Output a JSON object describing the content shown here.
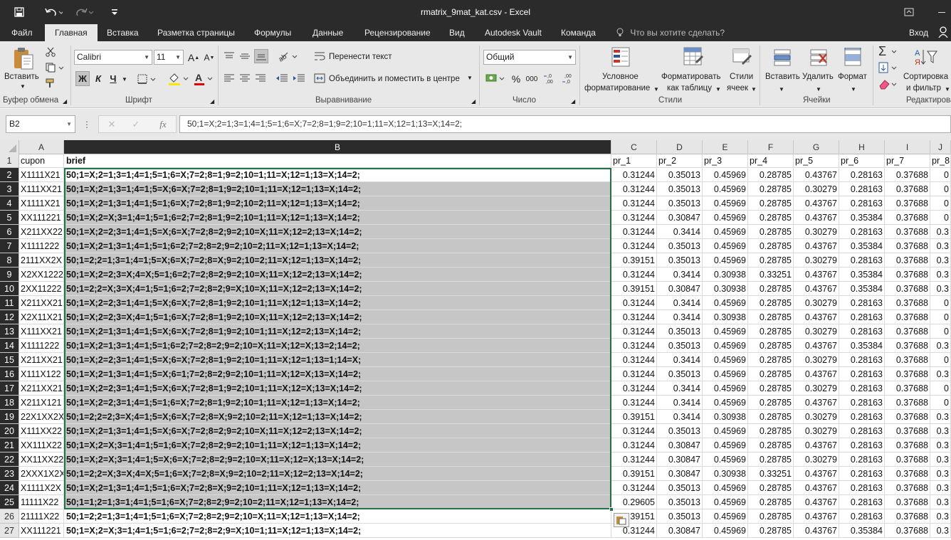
{
  "window": {
    "title": "rmatrix_9mat_kat.csv - Excel",
    "user": "Вход"
  },
  "tabs": [
    "Файл",
    "Главная",
    "Вставка",
    "Разметка страницы",
    "Формулы",
    "Данные",
    "Рецензирование",
    "Вид",
    "Autodesk Vault",
    "Команда"
  ],
  "active_tab": "Главная",
  "tell_me": "Что вы хотите сделать?",
  "ribbon": {
    "clipboard": {
      "paste": "Вставить",
      "group": "Буфер обмена"
    },
    "font": {
      "name": "Calibri",
      "size": "11",
      "bold": "Ж",
      "italic": "К",
      "underline": "Ч",
      "group": "Шрифт"
    },
    "alignment": {
      "wrap": "Перенести текст",
      "merge": "Объединить и поместить в центре",
      "group": "Выравнивание"
    },
    "number": {
      "format": "Общий",
      "group": "Число"
    },
    "styles": {
      "conditional_1": "Условное",
      "conditional_2": "форматирование",
      "format_table_1": "Форматировать",
      "format_table_2": "как таблицу",
      "cell_styles_1": "Стили",
      "cell_styles_2": "ячеек",
      "group": "Стили"
    },
    "cells": {
      "insert": "Вставить",
      "delete": "Удалить",
      "format": "Формат",
      "group": "Ячейки"
    },
    "editing": {
      "sort_1": "Сортировка",
      "sort_2": "и фильтр",
      "group": "Редактирование"
    }
  },
  "formula_bar": {
    "name_box": "B2",
    "fx": "fx",
    "value": "50;1=X;2=1;3=1;4=1;5=1;6=X;7=2;8=1;9=2;10=1;11=X;12=1;13=X;14=2;"
  },
  "sheet": {
    "columns": [
      "A",
      "B",
      "C",
      "D",
      "E",
      "F",
      "G",
      "H",
      "I",
      "J"
    ],
    "row_numbers": [
      "1",
      "2",
      "3",
      "4",
      "5",
      "6",
      "7",
      "8",
      "9",
      "10",
      "11",
      "12",
      "13",
      "14",
      "15",
      "16",
      "17",
      "18",
      "19",
      "20",
      "21",
      "22",
      "23",
      "24",
      "25",
      "26",
      "27"
    ],
    "header_row": [
      "cupon",
      "brief",
      "pr_1",
      "pr_2",
      "pr_3",
      "pr_4",
      "pr_5",
      "pr_6",
      "pr_7",
      "pr_8"
    ],
    "rows": [
      [
        "X1111X21",
        "50;1=X;2=1;3=1;4=1;5=1;6=X;7=2;8=1;9=2;10=1;11=X;12=1;13=X;14=2;",
        "0.31244",
        "0.35013",
        "0.45969",
        "0.28785",
        "0.43767",
        "0.28163",
        "0.37688",
        "0"
      ],
      [
        "X111XX21",
        "50;1=X;2=1;3=1;4=1;5=X;6=X;7=2;8=1;9=2;10=1;11=X;12=1;13=X;14=2;",
        "0.31244",
        "0.35013",
        "0.45969",
        "0.28785",
        "0.30279",
        "0.28163",
        "0.37688",
        "0"
      ],
      [
        "X1111X21",
        "50;1=X;2=1;3=1;4=1;5=1;6=X;7=2;8=1;9=2;10=2;11=X;12=1;13=X;14=2;",
        "0.31244",
        "0.35013",
        "0.45969",
        "0.28785",
        "0.43767",
        "0.28163",
        "0.37688",
        "0"
      ],
      [
        "XX111221",
        "50;1=X;2=X;3=1;4=1;5=1;6=2;7=2;8=1;9=2;10=1;11=X;12=1;13=X;14=2;",
        "0.31244",
        "0.30847",
        "0.45969",
        "0.28785",
        "0.43767",
        "0.35384",
        "0.37688",
        "0"
      ],
      [
        "X211XX22",
        "50;1=X;2=2;3=1;4=1;5=X;6=X;7=2;8=2;9=2;10=X;11=X;12=2;13=X;14=2;",
        "0.31244",
        "0.3414",
        "0.45969",
        "0.28785",
        "0.30279",
        "0.28163",
        "0.37688",
        "0.3"
      ],
      [
        "X1111222",
        "50;1=X;2=1;3=1;4=1;5=1;6=2;7=2;8=2;9=2;10=2;11=X;12=1;13=X;14=2;",
        "0.31244",
        "0.35013",
        "0.45969",
        "0.28785",
        "0.43767",
        "0.35384",
        "0.37688",
        "0.3"
      ],
      [
        "2111XX2X",
        "50;1=2;2=1;3=1;4=1;5=X;6=X;7=2;8=X;9=2;10=2;11=X;12=1;13=X;14=2;",
        "0.39151",
        "0.35013",
        "0.45969",
        "0.28785",
        "0.30279",
        "0.28163",
        "0.37688",
        "0.3"
      ],
      [
        "X2XX1222",
        "50;1=X;2=2;3=X;4=X;5=1;6=2;7=2;8=2;9=2;10=X;11=X;12=2;13=X;14=2;",
        "0.31244",
        "0.3414",
        "0.30938",
        "0.33251",
        "0.43767",
        "0.35384",
        "0.37688",
        "0.3"
      ],
      [
        "2XX11222",
        "50;1=2;2=X;3=X;4=1;5=1;6=2;7=2;8=2;9=X;10=X;11=X;12=2;13=X;14=2;",
        "0.39151",
        "0.30847",
        "0.30938",
        "0.28785",
        "0.43767",
        "0.35384",
        "0.37688",
        "0.3"
      ],
      [
        "X211XX21",
        "50;1=X;2=2;3=1;4=1;5=X;6=X;7=2;8=1;9=2;10=1;11=X;12=1;13=X;14=2;",
        "0.31244",
        "0.3414",
        "0.45969",
        "0.28785",
        "0.30279",
        "0.28163",
        "0.37688",
        "0"
      ],
      [
        "X2X11X21",
        "50;1=X;2=2;3=X;4=1;5=1;6=X;7=2;8=1;9=2;10=X;11=X;12=2;13=X;14=2;",
        "0.31244",
        "0.3414",
        "0.30938",
        "0.28785",
        "0.43767",
        "0.28163",
        "0.37688",
        "0"
      ],
      [
        "X111XX21",
        "50;1=X;2=1;3=1;4=1;5=X;6=X;7=2;8=1;9=2;10=1;11=X;12=2;13=X;14=2;",
        "0.31244",
        "0.35013",
        "0.45969",
        "0.28785",
        "0.30279",
        "0.28163",
        "0.37688",
        "0"
      ],
      [
        "X1111222",
        "50;1=X;2=1;3=1;4=1;5=1;6=2;7=2;8=2;9=2;10=X;11=X;12=X;13=2;14=2;",
        "0.31244",
        "0.35013",
        "0.45969",
        "0.28785",
        "0.43767",
        "0.35384",
        "0.37688",
        "0.3"
      ],
      [
        "X211XX21",
        "50;1=X;2=2;3=1;4=1;5=X;6=X;7=2;8=1;9=2;10=1;11=X;12=1;13=1;14=X;",
        "0.31244",
        "0.3414",
        "0.45969",
        "0.28785",
        "0.30279",
        "0.28163",
        "0.37688",
        "0"
      ],
      [
        "X111X122",
        "50;1=X;2=1;3=1;4=1;5=X;6=1;7=2;8=2;9=2;10=1;11=X;12=X;13=X;14=2;",
        "0.31244",
        "0.35013",
        "0.45969",
        "0.28785",
        "0.43767",
        "0.28163",
        "0.37688",
        "0.3"
      ],
      [
        "X211XX21",
        "50;1=X;2=2;3=1;4=1;5=X;6=X;7=2;8=1;9=2;10=1;11=X;12=X;13=X;14=2;",
        "0.31244",
        "0.3414",
        "0.45969",
        "0.28785",
        "0.30279",
        "0.28163",
        "0.37688",
        "0"
      ],
      [
        "X211X121",
        "50;1=X;2=2;3=1;4=1;5=1;6=X;7=2;8=1;9=2;10=1;11=X;12=1;13=X;14=2;",
        "0.31244",
        "0.3414",
        "0.45969",
        "0.28785",
        "0.43767",
        "0.28163",
        "0.37688",
        "0"
      ],
      [
        "22X1XX2X",
        "50;1=2;2=2;3=X;4=1;5=X;6=X;7=2;8=X;9=2;10=2;11=X;12=1;13=X;14=2;",
        "0.39151",
        "0.3414",
        "0.30938",
        "0.28785",
        "0.30279",
        "0.28163",
        "0.37688",
        "0.3"
      ],
      [
        "X111XX22",
        "50;1=X;2=1;3=1;4=1;5=X;6=X;7=2;8=2;9=2;10=X;11=X;12=2;13=X;14=2;",
        "0.31244",
        "0.35013",
        "0.45969",
        "0.28785",
        "0.30279",
        "0.28163",
        "0.37688",
        "0.3"
      ],
      [
        "XX111X22",
        "50;1=X;2=X;3=1;4=1;5=1;6=X;7=2;8=2;9=2;10=1;11=X;12=1;13=X;14=2;",
        "0.31244",
        "0.30847",
        "0.45969",
        "0.28785",
        "0.43767",
        "0.28163",
        "0.37688",
        "0.3"
      ],
      [
        "XX11XX22",
        "50;1=X;2=X;3=1;4=1;5=X;6=X;7=2;8=2;9=2;10=X;11=X;12=X;13=X;14=2;",
        "0.31244",
        "0.30847",
        "0.45969",
        "0.28785",
        "0.30279",
        "0.28163",
        "0.37688",
        "0.3"
      ],
      [
        "2XXX1X2X",
        "50;1=2;2=X;3=X;4=X;5=1;6=X;7=2;8=X;9=2;10=2;11=X;12=2;13=X;14=2;",
        "0.39151",
        "0.30847",
        "0.30938",
        "0.33251",
        "0.43767",
        "0.28163",
        "0.37688",
        "0.3"
      ],
      [
        "X1111X2X",
        "50;1=X;2=1;3=1;4=1;5=1;6=X;7=2;8=X;9=2;10=1;11=X;12=1;13=X;14=2;",
        "0.31244",
        "0.35013",
        "0.45969",
        "0.28785",
        "0.43767",
        "0.28163",
        "0.37688",
        "0.3"
      ],
      [
        "11111X22",
        "50;1=1;2=1;3=1;4=1;5=1;6=X;7=2;8=2;9=2;10=2;11=X;12=1;13=X;14=2;",
        "0.29605",
        "0.35013",
        "0.45969",
        "0.28785",
        "0.43767",
        "0.28163",
        "0.37688",
        "0.3"
      ],
      [
        "21111X22",
        "50;1=2;2=1;3=1;4=1;5=1;6=X;7=2;8=2;9=2;10=X;11=X;12=1;13=X;14=2;",
        "0.39151",
        "0.35013",
        "0.45969",
        "0.28785",
        "0.43767",
        "0.28163",
        "0.37688",
        "0.3"
      ],
      [
        "XX111221",
        "50;1=X;2=X;3=1;4=1;5=1;6=2;7=2;8=2;9=X;10=1;11=X;12=1;13=X;14=2;",
        "0.31244",
        "0.30847",
        "0.45969",
        "0.28785",
        "0.43767",
        "0.35384",
        "0.37688",
        "0.3"
      ]
    ]
  },
  "colors": {
    "titlebar_bg": "#2b2b2b",
    "ribbon_bg": "#e8e8e8",
    "selection_border": "#217346",
    "selection_fill": "#c6c6c6"
  }
}
